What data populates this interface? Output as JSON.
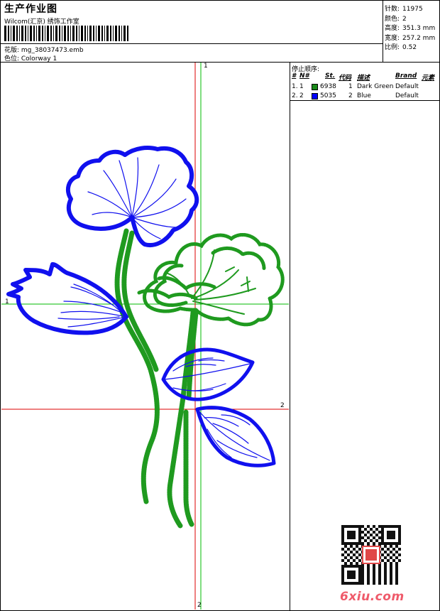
{
  "header": {
    "title": "生产作业图",
    "company": "Wilcom(汇京) 绣饰工作室"
  },
  "design": {
    "file_label": "花版: mg_38037473.emb",
    "colorway_label": "色位: Colorway 1"
  },
  "stats": [
    {
      "label": "针数:",
      "value": "11975"
    },
    {
      "label": "颜色:",
      "value": "2"
    },
    {
      "label": "高度:",
      "value": "351.3 mm"
    },
    {
      "label": "宽度:",
      "value": "257.2 mm"
    },
    {
      "label": "比例:",
      "value": "0.52"
    }
  ],
  "stop_sequence": {
    "title": "停止顺序:",
    "headers": {
      "hash": "#",
      "no": "N#",
      "st": "St.",
      "code": "代码",
      "desc": "描述",
      "brand": "Brand",
      "elem": "元素"
    },
    "rows": [
      {
        "idx": "1.",
        "no": "1",
        "color": "#1a8a1a",
        "st": "6938",
        "code": "1",
        "desc": "Dark Green",
        "brand": "Default"
      },
      {
        "idx": "2.",
        "no": "2",
        "color": "#0000ff",
        "st": "5035",
        "code": "2",
        "desc": "Blue",
        "brand": "Default"
      }
    ]
  },
  "axes": {
    "green_top": "1",
    "green_left": "1",
    "red_right": "2",
    "red_bottom": "2"
  },
  "colors": {
    "green_thread": "#1f9a1f",
    "blue_thread": "#1010ee",
    "axis_red": "#dd0000",
    "axis_green": "#00bb00"
  },
  "watermark": "6xiu.com"
}
